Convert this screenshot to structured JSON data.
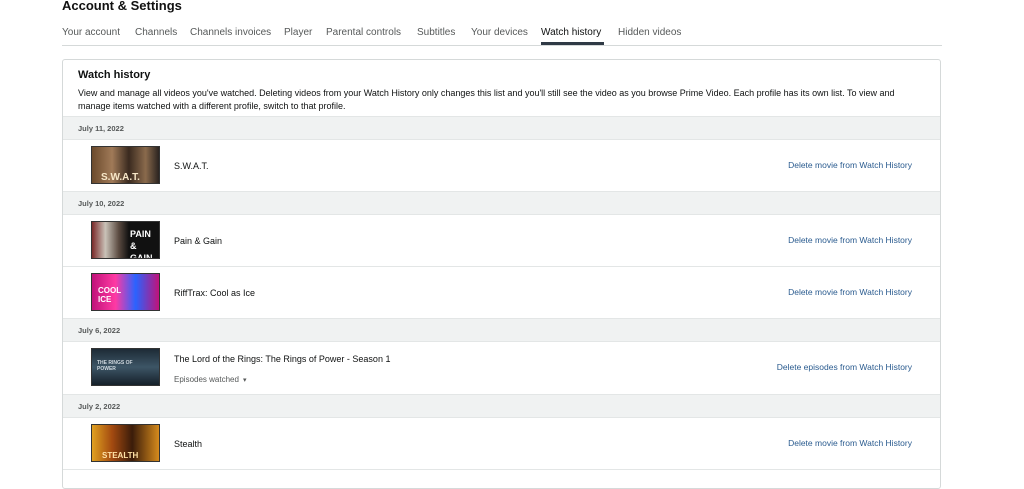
{
  "header": {
    "title": "Account & Settings"
  },
  "tabs": [
    {
      "label": "Your account"
    },
    {
      "label": "Channels"
    },
    {
      "label": "Channels invoices"
    },
    {
      "label": "Player"
    },
    {
      "label": "Parental controls"
    },
    {
      "label": "Subtitles"
    },
    {
      "label": "Your devices"
    },
    {
      "label": "Watch history",
      "active": true
    },
    {
      "label": "Hidden videos"
    }
  ],
  "watch_history": {
    "title": "Watch history",
    "description": "View and manage all videos you've watched. Deleting videos from your Watch History only changes this list and you'll still see the video as you browse Prime Video. Each profile has its own list. To view and manage items watched with a different profile, switch to that profile.",
    "groups": [
      {
        "date": "July 11, 2022",
        "items": [
          {
            "title": "S.W.A.T.",
            "action": "Delete movie from Watch History",
            "thumb_text": "S.W.A.T."
          }
        ]
      },
      {
        "date": "July 10, 2022",
        "items": [
          {
            "title": "Pain & Gain",
            "action": "Delete movie from Watch History",
            "thumb_text": "PAIN & GAIN"
          },
          {
            "title": "RiffTrax: Cool as Ice",
            "action": "Delete movie from Watch History",
            "thumb_text": "COOL ICE"
          }
        ]
      },
      {
        "date": "July 6, 2022",
        "items": [
          {
            "title": "The Lord of the Rings: The Rings of Power - Season 1",
            "action": "Delete episodes from Watch History",
            "episodes_label": "Episodes watched",
            "thumb_text": "THE RINGS OF POWER"
          }
        ]
      },
      {
        "date": "July 2, 2022",
        "items": [
          {
            "title": "Stealth",
            "action": "Delete movie from Watch History",
            "thumb_text": "STEALTH"
          }
        ]
      }
    ]
  },
  "colors": {
    "link": "#2a5b8f",
    "date_band": "#f0f2f2",
    "tab_underline": "#2f3a45"
  }
}
